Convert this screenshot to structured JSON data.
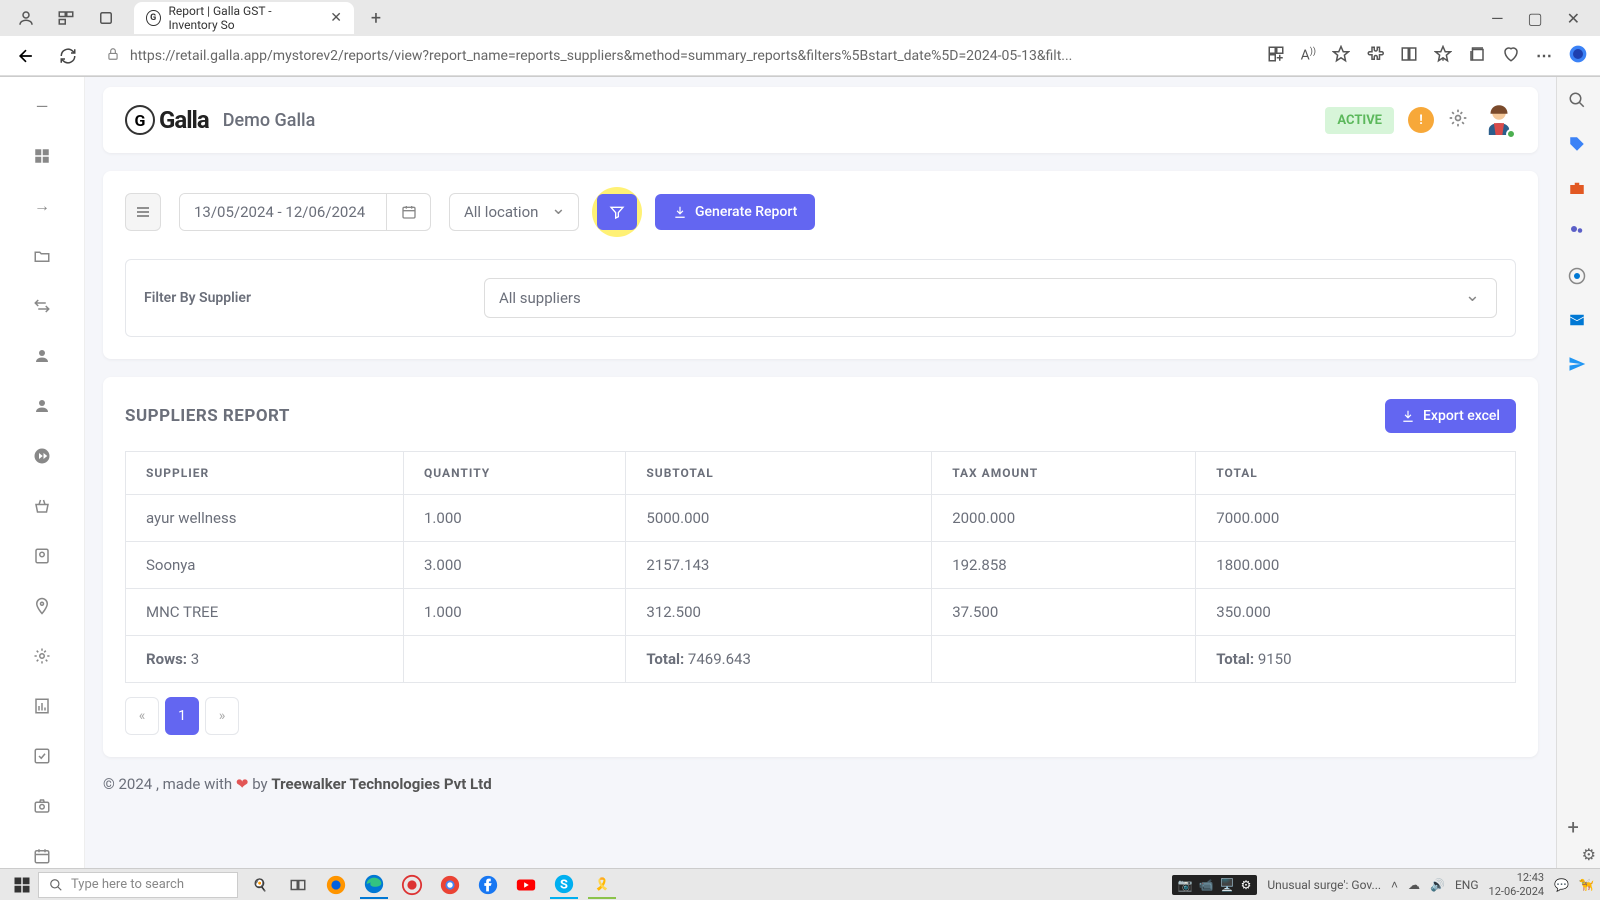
{
  "browser": {
    "tab_title": "Report | Galla GST - Inventory So",
    "url": "https://retail.galla.app/mystorev2/reports/view?report_name=reports_suppliers&method=summary_reports&filters%5Bstart_date%5D=2024-05-13&filt..."
  },
  "header": {
    "logo_text": "Galla",
    "brand_sub": "Demo Galla",
    "status_badge": "ACTIVE",
    "warn_badge": "!"
  },
  "filters": {
    "date_range": "13/05/2024 - 12/06/2024",
    "location_selected": "All location",
    "generate_label": "Generate Report",
    "filter_by_label": "Filter By Supplier",
    "supplier_selected": "All suppliers"
  },
  "report": {
    "title": "SUPPLIERS REPORT",
    "export_label": "Export excel",
    "columns": [
      "SUPPLIER",
      "QUANTITY",
      "SUBTOTAL",
      "TAX AMOUNT",
      "TOTAL"
    ],
    "rows": [
      {
        "supplier": "ayur wellness",
        "quantity": "1.000",
        "subtotal": "5000.000",
        "tax": "2000.000",
        "total": "7000.000"
      },
      {
        "supplier": "Soonya",
        "quantity": "3.000",
        "subtotal": "2157.143",
        "tax": "192.858",
        "total": "1800.000"
      },
      {
        "supplier": "MNC TREE",
        "quantity": "1.000",
        "subtotal": "312.500",
        "tax": "37.500",
        "total": "350.000"
      }
    ],
    "footer": {
      "rows_label": "Rows:",
      "rows_count": "3",
      "total_label": "Total:",
      "subtotal_sum": "7469.643",
      "grand_total": "9150"
    },
    "page_active": "1"
  },
  "page_footer": {
    "text_prefix": "© 2024 , made with ",
    "text_mid": " by ",
    "company": "Treewalker Technologies Pvt Ltd"
  },
  "status_link": "https://retail.galla.app/mystorev2/reports/view?report_name=reports_suppliers&method=summary_reports&filters%5Bstart_date%5D=2024-05-13&filters%5Bend_date%5D=2024-06-12#collapseMoreFilters",
  "taskbar": {
    "search_placeholder": "Type here to search",
    "news": "Unusual surge': Gov...",
    "lang": "ENG",
    "time": "12:43",
    "date": "12-06-2024"
  }
}
